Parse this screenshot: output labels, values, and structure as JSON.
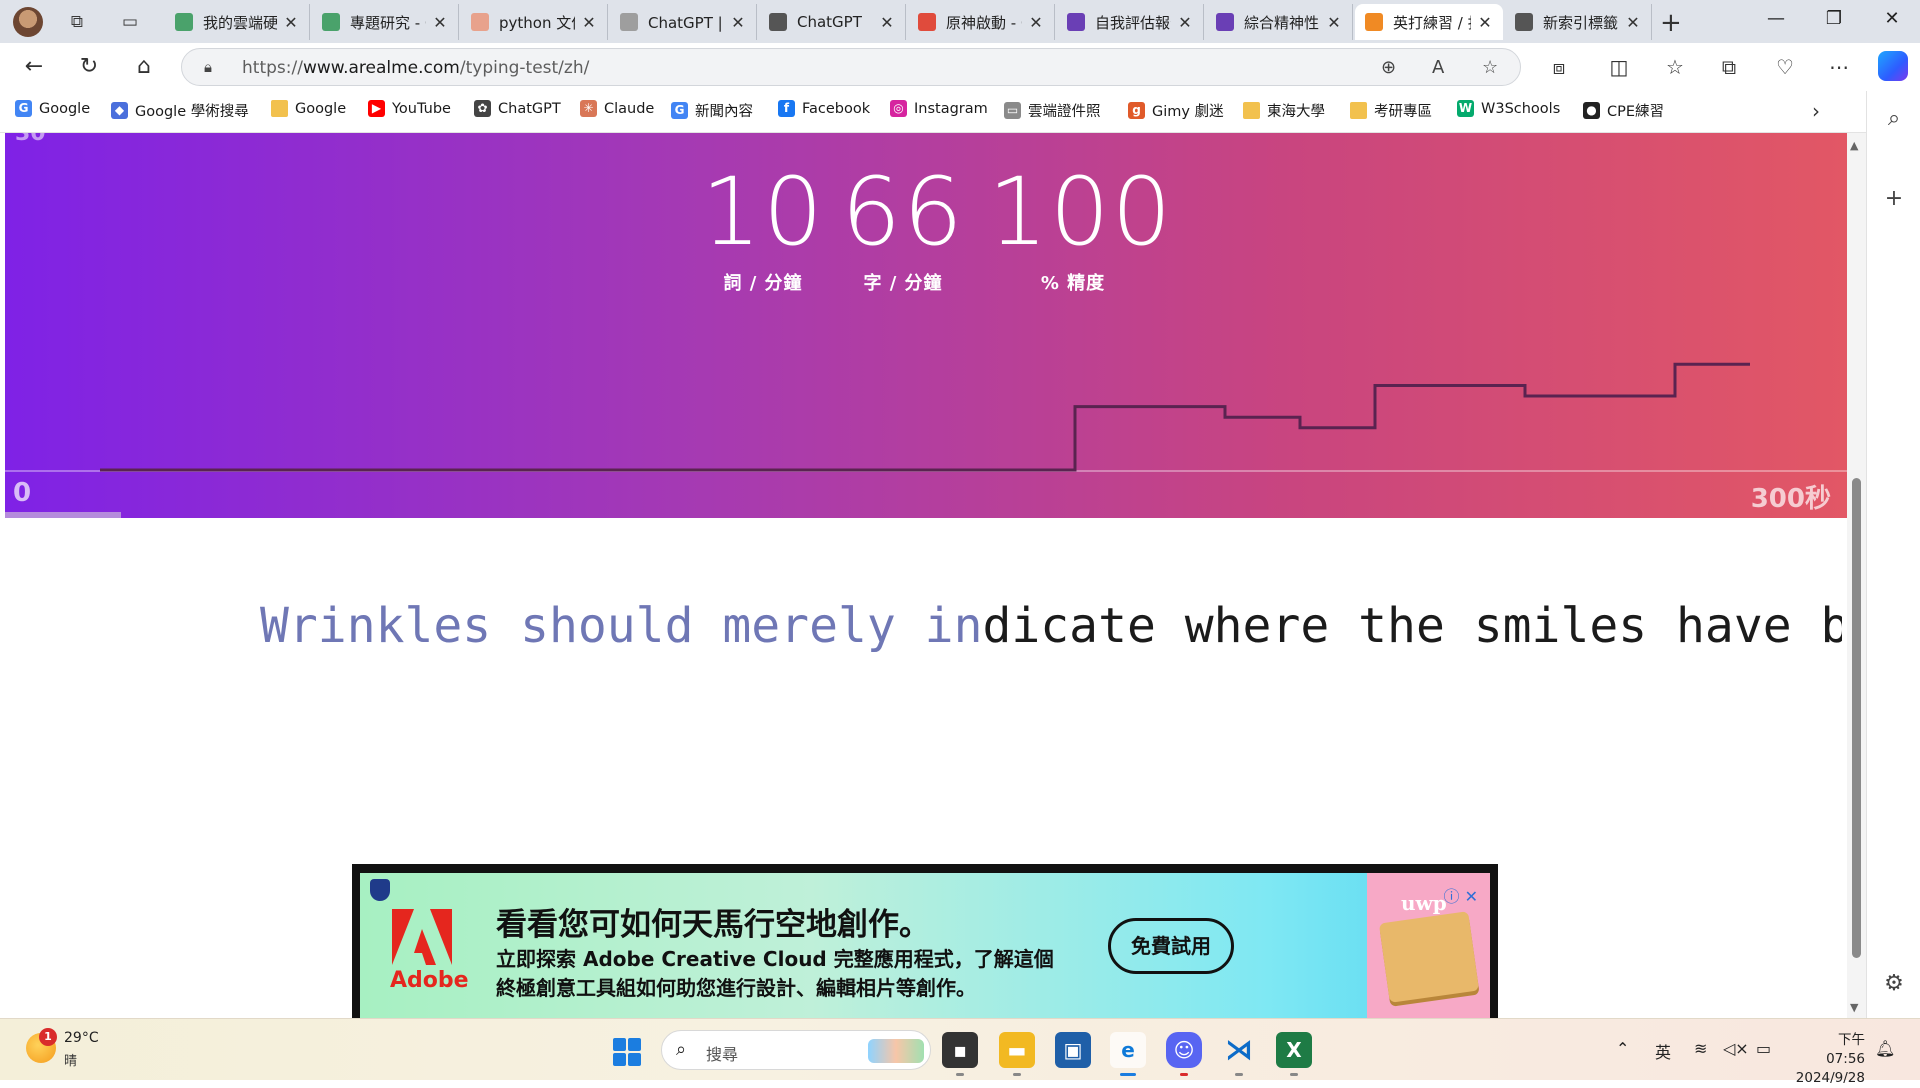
{
  "tabs": [
    {
      "title": "我的雲端硬碟",
      "fav_color": "#4aa26b"
    },
    {
      "title": "專題研究 - Google 雲端硬碟",
      "fav_color": "#4aa26b"
    },
    {
      "title": "python 文件",
      "fav_color": "#e8a28c"
    },
    {
      "title": "ChatGPT | 登入",
      "fav_color": "#9e9e9e"
    },
    {
      "title": "ChatGPT",
      "fav_color": "#555555"
    },
    {
      "title": "原神啟動 - Google 表單",
      "fav_color": "#e04b3c"
    },
    {
      "title": "自我評估報告",
      "fav_color": "#6a3fb5"
    },
    {
      "title": "綜合精神性",
      "fav_color": "#6a3fb5"
    },
    {
      "title": "英打練習 / 打字速度測試",
      "fav_color": "#f08a24",
      "active": true
    },
    {
      "title": "新索引標籤",
      "fav_color": "#555555"
    }
  ],
  "window_controls": {
    "minimize": "—",
    "restore": "❐",
    "close": "✕"
  },
  "address_bar": {
    "url_prefix": "https://",
    "url_host": "www.arealme.com",
    "url_path": "/typing-test/zh/"
  },
  "bookmarks": [
    {
      "label": "Google",
      "icon": "google-icon",
      "color": "#4285f4",
      "glyph": "G"
    },
    {
      "label": "Google 學術搜尋",
      "icon": "scholar-icon",
      "color": "#4a6fdc",
      "glyph": "◆"
    },
    {
      "label": "Google",
      "icon": "folder-icon",
      "color": "#f2c14e",
      "glyph": ""
    },
    {
      "label": "YouTube",
      "icon": "youtube-icon",
      "color": "#ff0000",
      "glyph": "▶"
    },
    {
      "label": "ChatGPT",
      "icon": "chatgpt-icon",
      "color": "#444444",
      "glyph": "✿"
    },
    {
      "label": "Claude",
      "icon": "claude-icon",
      "color": "#d97757",
      "glyph": "✳"
    },
    {
      "label": "新聞內容",
      "icon": "news-icon",
      "color": "#4285f4",
      "glyph": "G"
    },
    {
      "label": "Facebook",
      "icon": "facebook-icon",
      "color": "#1877f2",
      "glyph": "f"
    },
    {
      "label": "Instagram",
      "icon": "instagram-icon",
      "color": "#d6249f",
      "glyph": "◎"
    },
    {
      "label": "雲端證件照",
      "icon": "page-icon",
      "color": "#8a8a8a",
      "glyph": "▭"
    },
    {
      "label": "Gimy 劇迷",
      "icon": "gimy-icon",
      "color": "#e05a2a",
      "glyph": "g"
    },
    {
      "label": "東海大學",
      "icon": "folder-icon",
      "color": "#f2c14e",
      "glyph": ""
    },
    {
      "label": "考研專區",
      "icon": "folder-icon",
      "color": "#f2c14e",
      "glyph": ""
    },
    {
      "label": "W3Schools",
      "icon": "w3schools-icon",
      "color": "#04aa6d",
      "glyph": "W"
    },
    {
      "label": "CPE練習",
      "icon": "github-icon",
      "color": "#222222",
      "glyph": "●"
    }
  ],
  "typing_test": {
    "stats": [
      {
        "value": "10",
        "label": "詞 / 分鐘"
      },
      {
        "value": "66",
        "label": "字 / 分鐘"
      },
      {
        "value": "100",
        "label": "% 精度"
      }
    ],
    "graph_y_max": "30",
    "graph_x_min": "0",
    "graph_x_max": "300秒",
    "elapsed_fraction": 0.063,
    "wpm_trace": [
      0,
      0,
      0,
      0,
      0,
      0,
      0,
      0,
      0,
      0,
      0,
      0,
      0,
      6,
      6,
      5,
      4,
      8,
      8,
      7,
      7,
      10,
      10
    ],
    "sentence_typed": "Wrinkles should merely in",
    "sentence_remaining": "dicate where the smiles have been."
  },
  "ad": {
    "brand": "Adobe",
    "headline": "看看您可如何天馬行空地創作。",
    "body": "立即探索 Adobe Creative Cloud 完整應用程式，了解這個終極創意工具組如何助您進行設計、編輯相片等創作。",
    "cta": "免費試用",
    "product_brand": "uwp",
    "controls": "ⓘ ✕"
  },
  "taskbar": {
    "weather_badge": "1",
    "temperature": "29°C",
    "weather": "晴",
    "search_placeholder": "搜尋",
    "ime": "英",
    "time": "下午 07:56",
    "date": "2024/9/28"
  }
}
